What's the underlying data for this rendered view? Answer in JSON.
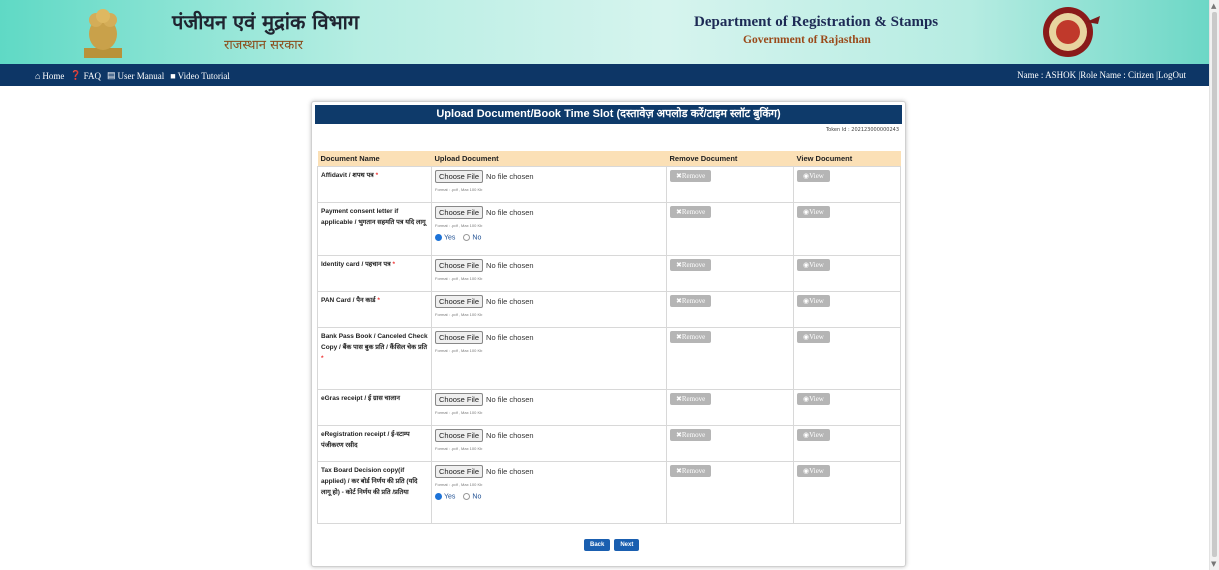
{
  "header": {
    "hindi_title": "पंजीयन एवं मुद्रांक विभाग",
    "hindi_subtitle": "राजस्थान सरकार",
    "english_title": "Department of Registration & Stamps",
    "english_subtitle": "Government of Rajasthan"
  },
  "nav": {
    "home": "Home",
    "faq": "FAQ",
    "manual": "User Manual",
    "video": "Video Tutorial",
    "user_info": "Name : ASHOK |Role Name : Citizen |LogOut"
  },
  "panel": {
    "title": "Upload Document/Book Time Slot (दस्तावेज़ अपलोड करें/टाइम स्लॉट बुकिंग)",
    "token": "Token Id : 202123000000243"
  },
  "table": {
    "headers": [
      "Document Name",
      "Upload Document",
      "Remove Document",
      "View Document"
    ],
    "choose_label": "Choose File",
    "no_file": "No file chosen",
    "format_note": "Format : .pdf , Max 100 Kb",
    "remove_label": "✖Remove",
    "view_label": "◉View",
    "yes_label": "Yes",
    "no_label": "No",
    "rows": [
      {
        "name": "Affidavit / शपथ पत्र",
        "required": "*"
      },
      {
        "name": "Payment consent letter if applicable / भुगतान सहमति पत्र यदि लागू",
        "required": ""
      },
      {
        "name": "Identity card / पहचान पत्र",
        "required": "*"
      },
      {
        "name": "PAN Card / पैन कार्ड",
        "required": "*"
      },
      {
        "name": "Bank Pass Book / Canceled Check Copy / बैंक पास बुक प्रति / कैंसिल चेक प्रति",
        "required": "*"
      },
      {
        "name": "eGras receipt / ई ग्रास चालान",
        "required": ""
      },
      {
        "name": "eRegistration receipt / ई-स्टाम्प पंजीकरण रसीद",
        "required": ""
      },
      {
        "name": "Tax Board Decision copy(if applied) / कर बोर्ड निर्णय की प्रति (यदि लागू हो) - कोर्ट निर्णय की प्रति /प्रतिया",
        "required": ""
      }
    ]
  },
  "buttons": {
    "back": "Back",
    "next": "Next"
  }
}
